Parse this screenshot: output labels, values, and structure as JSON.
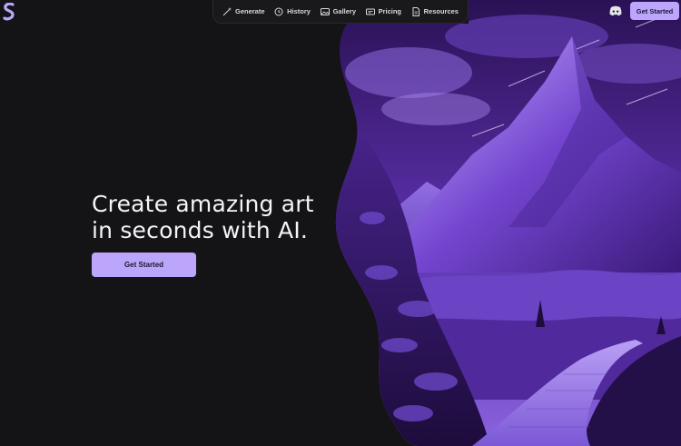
{
  "brand": {
    "logo_icon": "s-logo-icon",
    "accent": "#bca6fb"
  },
  "nav": {
    "items": [
      {
        "label": "Generate",
        "icon": "magic-wand-icon"
      },
      {
        "label": "History",
        "icon": "history-icon"
      },
      {
        "label": "Gallery",
        "icon": "image-icon"
      },
      {
        "label": "Pricing",
        "icon": "price-tag-icon"
      },
      {
        "label": "Resources",
        "icon": "document-icon"
      }
    ]
  },
  "header": {
    "discord_icon": "discord-icon",
    "cta_label": "Get Started"
  },
  "hero": {
    "headline_line1": "Create amazing art",
    "headline_line2": "in seconds with AI.",
    "cta_label": "Get Started",
    "image_subject": "purple mountain landscape illustration",
    "colors": {
      "background": "#141416",
      "purple_light": "#c9b3ff",
      "purple_dark": "#2a1150"
    }
  }
}
